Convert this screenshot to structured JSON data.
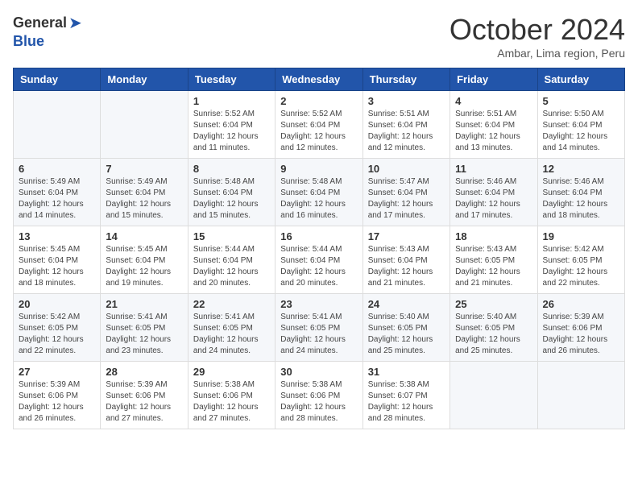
{
  "header": {
    "logo_general": "General",
    "logo_blue": "Blue",
    "month_title": "October 2024",
    "subtitle": "Ambar, Lima region, Peru"
  },
  "calendar": {
    "days_of_week": [
      "Sunday",
      "Monday",
      "Tuesday",
      "Wednesday",
      "Thursday",
      "Friday",
      "Saturday"
    ],
    "weeks": [
      [
        {
          "day": "",
          "info": ""
        },
        {
          "day": "",
          "info": ""
        },
        {
          "day": "1",
          "info": "Sunrise: 5:52 AM\nSunset: 6:04 PM\nDaylight: 12 hours and 11 minutes."
        },
        {
          "day": "2",
          "info": "Sunrise: 5:52 AM\nSunset: 6:04 PM\nDaylight: 12 hours and 12 minutes."
        },
        {
          "day": "3",
          "info": "Sunrise: 5:51 AM\nSunset: 6:04 PM\nDaylight: 12 hours and 12 minutes."
        },
        {
          "day": "4",
          "info": "Sunrise: 5:51 AM\nSunset: 6:04 PM\nDaylight: 12 hours and 13 minutes."
        },
        {
          "day": "5",
          "info": "Sunrise: 5:50 AM\nSunset: 6:04 PM\nDaylight: 12 hours and 14 minutes."
        }
      ],
      [
        {
          "day": "6",
          "info": "Sunrise: 5:49 AM\nSunset: 6:04 PM\nDaylight: 12 hours and 14 minutes."
        },
        {
          "day": "7",
          "info": "Sunrise: 5:49 AM\nSunset: 6:04 PM\nDaylight: 12 hours and 15 minutes."
        },
        {
          "day": "8",
          "info": "Sunrise: 5:48 AM\nSunset: 6:04 PM\nDaylight: 12 hours and 15 minutes."
        },
        {
          "day": "9",
          "info": "Sunrise: 5:48 AM\nSunset: 6:04 PM\nDaylight: 12 hours and 16 minutes."
        },
        {
          "day": "10",
          "info": "Sunrise: 5:47 AM\nSunset: 6:04 PM\nDaylight: 12 hours and 17 minutes."
        },
        {
          "day": "11",
          "info": "Sunrise: 5:46 AM\nSunset: 6:04 PM\nDaylight: 12 hours and 17 minutes."
        },
        {
          "day": "12",
          "info": "Sunrise: 5:46 AM\nSunset: 6:04 PM\nDaylight: 12 hours and 18 minutes."
        }
      ],
      [
        {
          "day": "13",
          "info": "Sunrise: 5:45 AM\nSunset: 6:04 PM\nDaylight: 12 hours and 18 minutes."
        },
        {
          "day": "14",
          "info": "Sunrise: 5:45 AM\nSunset: 6:04 PM\nDaylight: 12 hours and 19 minutes."
        },
        {
          "day": "15",
          "info": "Sunrise: 5:44 AM\nSunset: 6:04 PM\nDaylight: 12 hours and 20 minutes."
        },
        {
          "day": "16",
          "info": "Sunrise: 5:44 AM\nSunset: 6:04 PM\nDaylight: 12 hours and 20 minutes."
        },
        {
          "day": "17",
          "info": "Sunrise: 5:43 AM\nSunset: 6:04 PM\nDaylight: 12 hours and 21 minutes."
        },
        {
          "day": "18",
          "info": "Sunrise: 5:43 AM\nSunset: 6:05 PM\nDaylight: 12 hours and 21 minutes."
        },
        {
          "day": "19",
          "info": "Sunrise: 5:42 AM\nSunset: 6:05 PM\nDaylight: 12 hours and 22 minutes."
        }
      ],
      [
        {
          "day": "20",
          "info": "Sunrise: 5:42 AM\nSunset: 6:05 PM\nDaylight: 12 hours and 22 minutes."
        },
        {
          "day": "21",
          "info": "Sunrise: 5:41 AM\nSunset: 6:05 PM\nDaylight: 12 hours and 23 minutes."
        },
        {
          "day": "22",
          "info": "Sunrise: 5:41 AM\nSunset: 6:05 PM\nDaylight: 12 hours and 24 minutes."
        },
        {
          "day": "23",
          "info": "Sunrise: 5:41 AM\nSunset: 6:05 PM\nDaylight: 12 hours and 24 minutes."
        },
        {
          "day": "24",
          "info": "Sunrise: 5:40 AM\nSunset: 6:05 PM\nDaylight: 12 hours and 25 minutes."
        },
        {
          "day": "25",
          "info": "Sunrise: 5:40 AM\nSunset: 6:05 PM\nDaylight: 12 hours and 25 minutes."
        },
        {
          "day": "26",
          "info": "Sunrise: 5:39 AM\nSunset: 6:06 PM\nDaylight: 12 hours and 26 minutes."
        }
      ],
      [
        {
          "day": "27",
          "info": "Sunrise: 5:39 AM\nSunset: 6:06 PM\nDaylight: 12 hours and 26 minutes."
        },
        {
          "day": "28",
          "info": "Sunrise: 5:39 AM\nSunset: 6:06 PM\nDaylight: 12 hours and 27 minutes."
        },
        {
          "day": "29",
          "info": "Sunrise: 5:38 AM\nSunset: 6:06 PM\nDaylight: 12 hours and 27 minutes."
        },
        {
          "day": "30",
          "info": "Sunrise: 5:38 AM\nSunset: 6:06 PM\nDaylight: 12 hours and 28 minutes."
        },
        {
          "day": "31",
          "info": "Sunrise: 5:38 AM\nSunset: 6:07 PM\nDaylight: 12 hours and 28 minutes."
        },
        {
          "day": "",
          "info": ""
        },
        {
          "day": "",
          "info": ""
        }
      ]
    ]
  }
}
